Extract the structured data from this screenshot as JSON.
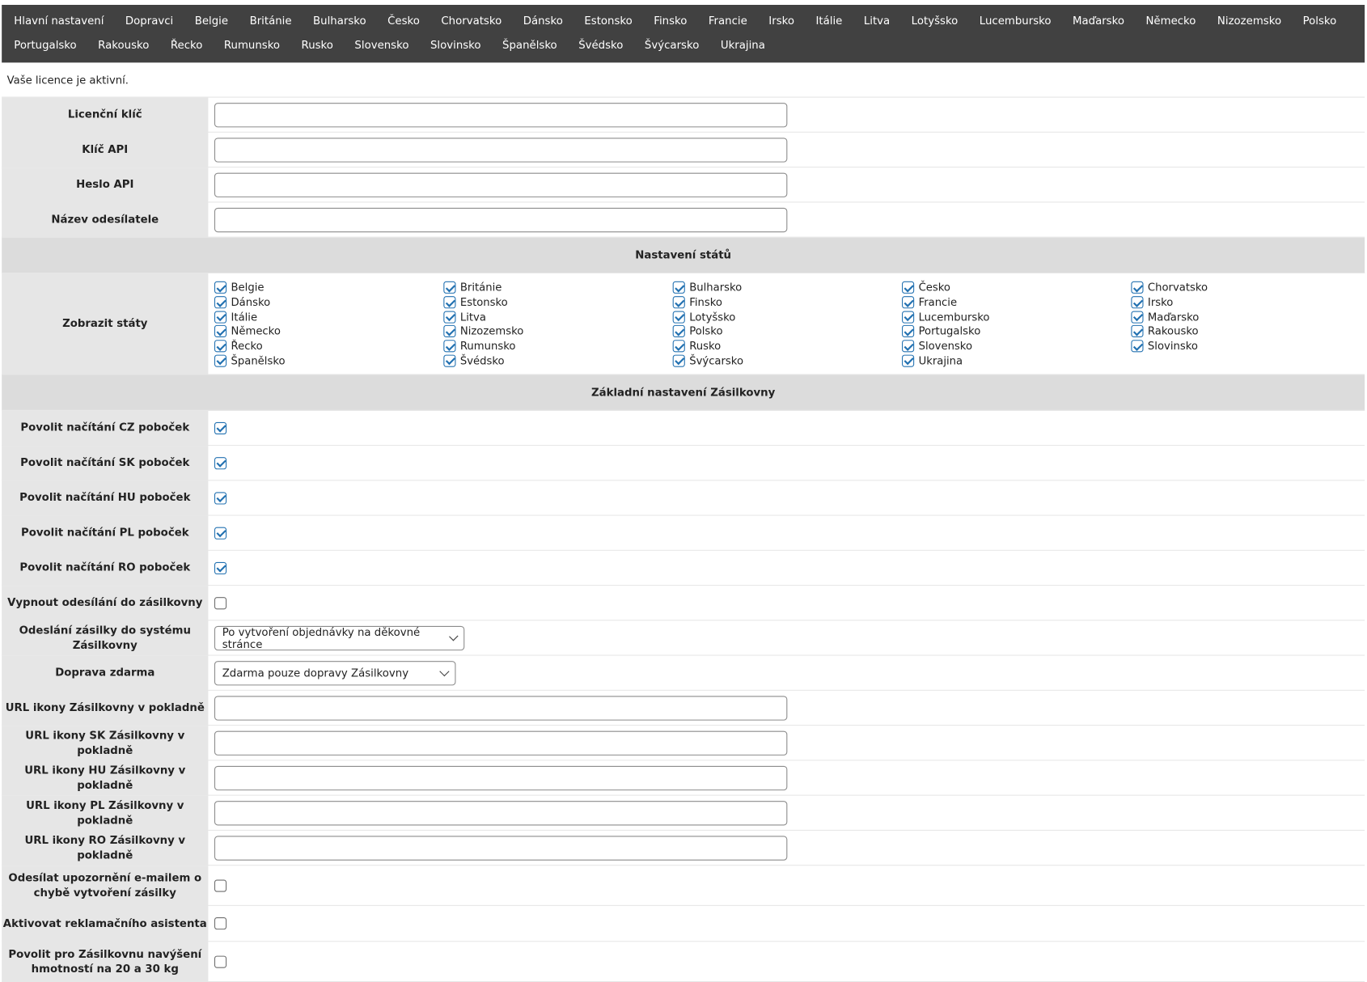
{
  "nav": {
    "row1": [
      "Hlavní nastavení",
      "Dopravci",
      "Belgie",
      "Británie",
      "Bulharsko",
      "Česko",
      "Chorvatsko",
      "Dánsko",
      "Estonsko",
      "Finsko",
      "Francie",
      "Irsko",
      "Itálie",
      "Litva",
      "Lotyšsko",
      "Lucembursko",
      "Maďarsko",
      "Německo",
      "Nizozemsko",
      "Polsko"
    ],
    "row2": [
      "Portugalsko",
      "Rakousko",
      "Řecko",
      "Rumunsko",
      "Rusko",
      "Slovensko",
      "Slovinsko",
      "Španělsko",
      "Švédsko",
      "Švýcarsko",
      "Ukrajina"
    ]
  },
  "license_status": "Vaše licence je aktivní.",
  "fields": {
    "license_key": "Licenční klíč",
    "api_key": "Klíč API",
    "api_password": "Heslo API",
    "sender_name": "Název odesílatele"
  },
  "states_section": {
    "title": "Nastavení států",
    "label": "Zobrazit státy",
    "countries": [
      {
        "name": "Belgie",
        "checked": true
      },
      {
        "name": "Británie",
        "checked": true
      },
      {
        "name": "Bulharsko",
        "checked": true
      },
      {
        "name": "Česko",
        "checked": true
      },
      {
        "name": "Chorvatsko",
        "checked": true
      },
      {
        "name": "Dánsko",
        "checked": true
      },
      {
        "name": "Estonsko",
        "checked": true
      },
      {
        "name": "Finsko",
        "checked": true
      },
      {
        "name": "Francie",
        "checked": true
      },
      {
        "name": "Irsko",
        "checked": true
      },
      {
        "name": "Itálie",
        "checked": true
      },
      {
        "name": "Litva",
        "checked": true
      },
      {
        "name": "Lotyšsko",
        "checked": true
      },
      {
        "name": "Lucembursko",
        "checked": true
      },
      {
        "name": "Maďarsko",
        "checked": true
      },
      {
        "name": "Německo",
        "checked": true
      },
      {
        "name": "Nizozemsko",
        "checked": true
      },
      {
        "name": "Polsko",
        "checked": true
      },
      {
        "name": "Portugalsko",
        "checked": true
      },
      {
        "name": "Rakousko",
        "checked": true
      },
      {
        "name": "Řecko",
        "checked": true
      },
      {
        "name": "Rumunsko",
        "checked": true
      },
      {
        "name": "Rusko",
        "checked": true
      },
      {
        "name": "Slovensko",
        "checked": true
      },
      {
        "name": "Slovinsko",
        "checked": true
      },
      {
        "name": "Španělsko",
        "checked": true
      },
      {
        "name": "Švédsko",
        "checked": true
      },
      {
        "name": "Švýcarsko",
        "checked": true
      },
      {
        "name": "Ukrajina",
        "checked": true
      }
    ]
  },
  "basic_section": {
    "title": "Základní nastavení Zásilkovny",
    "allow_cz": {
      "label": "Povolit načítání CZ poboček",
      "checked": true
    },
    "allow_sk": {
      "label": "Povolit načítání SK poboček",
      "checked": true
    },
    "allow_hu": {
      "label": "Povolit načítání HU poboček",
      "checked": true
    },
    "allow_pl": {
      "label": "Povolit načítání PL poboček",
      "checked": true
    },
    "allow_ro": {
      "label": "Povolit načítání RO poboček",
      "checked": true
    },
    "disable_sending": {
      "label": "Vypnout odesílání do zásilkovny",
      "checked": false
    },
    "send_mode": {
      "label": "Odeslání zásilky do systému Zásilkovny",
      "value": "Po vytvoření objednávky na děkovné stránce"
    },
    "free_shipping": {
      "label": "Doprava zdarma",
      "value": "Zdarma pouze dopravy Zásilkovny"
    },
    "icon_url": "URL ikony Zásilkovny v pokladně",
    "icon_url_sk": "URL ikony SK Zásilkovny v pokladně",
    "icon_url_hu": "URL ikony HU Zásilkovny v pokladně",
    "icon_url_pl": "URL ikony PL Zásilkovny v pokladně",
    "icon_url_ro": "URL ikony RO Zásilkovny v pokladně",
    "email_notify": {
      "label": "Odesílat upozornění e-mailem o chybě vytvoření zásilky",
      "checked": false
    },
    "claim_assistant": {
      "label": "Aktivovat reklamačního asistenta",
      "checked": false
    },
    "weight_increase": {
      "label": "Povolit pro Zásilkovnu navýšení hmotností na 20 a 30 kg",
      "checked": false
    }
  },
  "colors": {
    "nav_bg": "#414141",
    "label_bg": "#e6e6e6",
    "section_bg": "#dcdcdc",
    "accent": "#2271b1"
  }
}
